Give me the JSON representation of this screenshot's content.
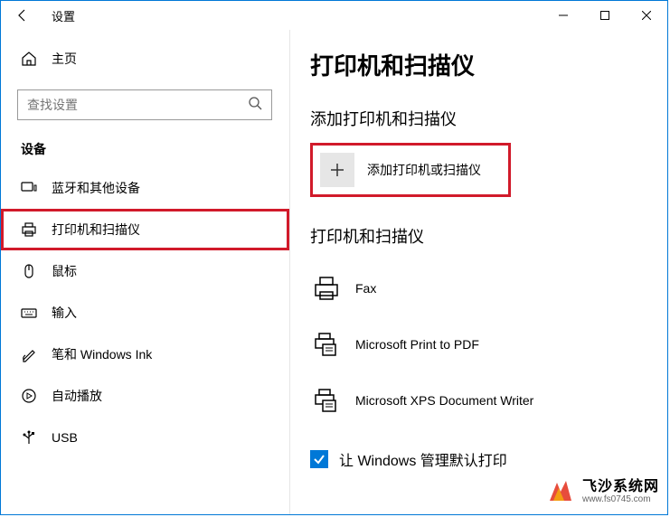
{
  "window": {
    "title": "设置"
  },
  "sidebar": {
    "home": "主页",
    "search_placeholder": "查找设置",
    "section": "设备",
    "items": [
      {
        "label": "蓝牙和其他设备"
      },
      {
        "label": "打印机和扫描仪"
      },
      {
        "label": "鼠标"
      },
      {
        "label": "输入"
      },
      {
        "label": "笔和 Windows Ink"
      },
      {
        "label": "自动播放"
      },
      {
        "label": "USB"
      }
    ]
  },
  "content": {
    "title": "打印机和扫描仪",
    "add_section": "添加打印机和扫描仪",
    "add_button": "添加打印机或扫描仪",
    "list_section": "打印机和扫描仪",
    "devices": [
      {
        "label": "Fax"
      },
      {
        "label": "Microsoft Print to PDF"
      },
      {
        "label": "Microsoft XPS Document Writer"
      }
    ],
    "checkbox_label": "让 Windows 管理默认打印"
  },
  "watermark": {
    "line1": "飞沙系统网",
    "line2": "www.fs0745.com"
  }
}
